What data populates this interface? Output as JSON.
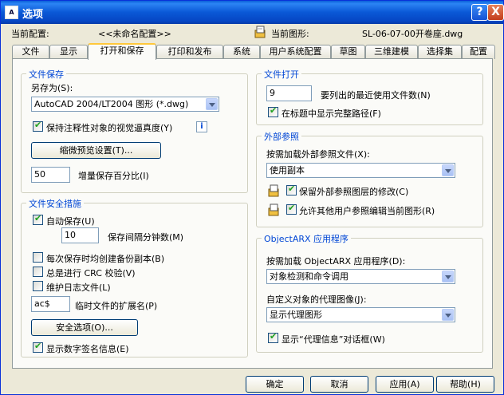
{
  "window": {
    "title": "选项",
    "icon": "autocad-icon",
    "help": "?",
    "close": "X"
  },
  "header": {
    "current_profile_label": "当前配置:",
    "current_profile_value": "<<未命名配置>>",
    "current_drawing_label": "当前图形:",
    "current_drawing_value": "SL-06-07-00开卷座.dwg"
  },
  "tabs": [
    "文件",
    "显示",
    "打开和保存",
    "打印和发布",
    "系统",
    "用户系统配置",
    "草图",
    "三维建模",
    "选择集",
    "配置"
  ],
  "active_tab": 2,
  "file_save": {
    "title": "文件保存",
    "save_as_label": "另存为(S):",
    "save_as_value": "AutoCAD 2004/LT2004 图形 (*.dwg)",
    "keep_annotative_label": "保持注释性对象的视觉逼真度(Y)",
    "keep_annotative_checked": true,
    "thumbnail_button": "缩微预览设置(T)...",
    "incremental_value": "50",
    "incremental_label": "增量保存百分比(I)"
  },
  "file_safety": {
    "title": "文件安全措施",
    "autosave_label": "自动保存(U)",
    "autosave_checked": true,
    "minutes_value": "10",
    "minutes_label": "保存间隔分钟数(M)",
    "backup_label": "每次保存时均创建备份副本(B)",
    "backup_checked": false,
    "crc_label": "总是进行 CRC 校验(V)",
    "crc_checked": false,
    "log_label": "维护日志文件(L)",
    "log_checked": false,
    "temp_ext_value": "ac$",
    "temp_ext_label": "临时文件的扩展名(P)",
    "security_button": "安全选项(O)...",
    "digital_sig_label": "显示数字签名信息(E)",
    "digital_sig_checked": true
  },
  "file_open": {
    "title": "文件打开",
    "recent_value": "9",
    "recent_label": "要列出的最近使用文件数(N)",
    "full_path_label": "在标题中显示完整路径(F)",
    "full_path_checked": true
  },
  "xref": {
    "title": "外部参照",
    "demand_load_label": "按需加载外部参照文件(X):",
    "demand_load_value": "使用副本",
    "retain_changes_label": "保留外部参照图层的修改(C)",
    "retain_changes_checked": true,
    "allow_edit_label": "允许其他用户参照编辑当前图形(R)",
    "allow_edit_checked": true
  },
  "arx": {
    "title": "ObjectARX 应用程序",
    "demand_load_label": "按需加载 ObjectARX 应用程序(D):",
    "demand_load_value": "对象检测和命令调用",
    "proxy_images_label": "自定义对象的代理图像(J):",
    "proxy_images_value": "显示代理图形",
    "show_proxy_label": "显示“代理信息”对话框(W)",
    "show_proxy_checked": true
  },
  "buttons": {
    "ok": "确定",
    "cancel": "取消",
    "apply": "应用(A)",
    "help": "帮助(H)"
  }
}
